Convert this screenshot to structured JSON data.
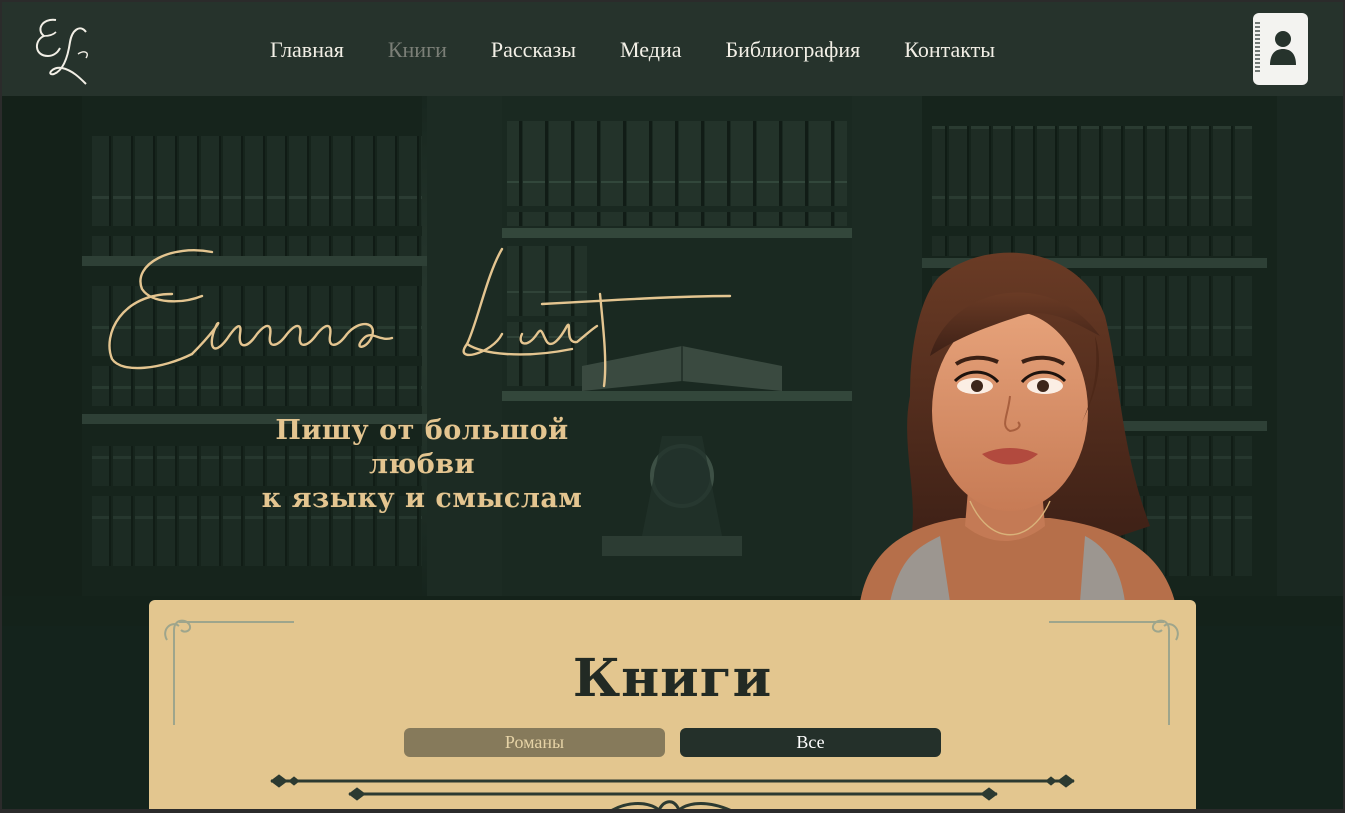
{
  "logo": {
    "text": "EL"
  },
  "nav": {
    "items": [
      {
        "label": "Главная",
        "active": false
      },
      {
        "label": "Книги",
        "active": true
      },
      {
        "label": "Рассказы",
        "active": false
      },
      {
        "label": "Медиа",
        "active": false
      },
      {
        "label": "Библиография",
        "active": false
      },
      {
        "label": "Контакты",
        "active": false
      }
    ],
    "contact_icon": "address-book-icon"
  },
  "hero": {
    "signature": "Emma Lust",
    "tagline_line1": "Пишу от большой любви",
    "tagline_line2": "к языку и смыслам"
  },
  "books": {
    "title": "Книги",
    "filters": [
      {
        "label": "Романы",
        "selected": false
      },
      {
        "label": "Все",
        "selected": true
      }
    ]
  },
  "colors": {
    "nav_bg": "#26332c",
    "gold": "#e4c590",
    "panel": "#e3c68f",
    "dark_green": "#24302a"
  }
}
